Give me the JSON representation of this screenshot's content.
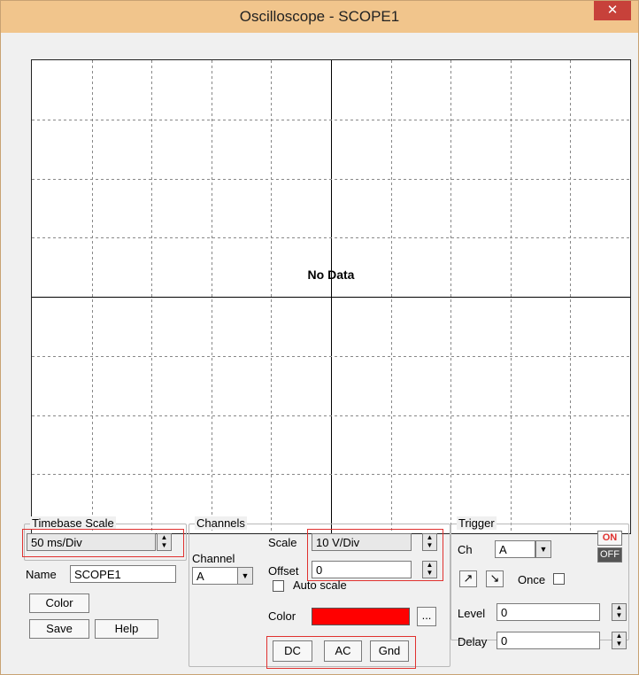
{
  "window": {
    "title": "Oscilloscope - SCOPE1",
    "close_glyph": "✕"
  },
  "display": {
    "empty_message": "No Data",
    "grid_columns": 10,
    "grid_rows": 8
  },
  "timebase": {
    "legend": "Timebase Scale",
    "value": "50 ms/Div",
    "name_label": "Name",
    "name_value": "SCOPE1",
    "color_button": "Color",
    "save_button": "Save",
    "help_button": "Help"
  },
  "channels": {
    "legend": "Channels",
    "channel_label": "Channel",
    "channel_value": "A",
    "scale_label": "Scale",
    "scale_value": "10  V/Div",
    "offset_label": "Offset",
    "offset_value": "0",
    "auto_scale_label": "Auto scale",
    "auto_scale_checked": false,
    "color_label": "Color",
    "color_value": "#ff0000",
    "color_picker_button": "...",
    "coupling_buttons": [
      "DC",
      "AC",
      "Gnd"
    ]
  },
  "trigger": {
    "legend": "Trigger",
    "ch_label": "Ch",
    "ch_value": "A",
    "on_label": "ON",
    "off_label": "OFF",
    "rising_edge_icon": "rising-edge-icon",
    "falling_edge_icon": "falling-edge-icon",
    "once_label": "Once",
    "once_checked": false,
    "level_label": "Level",
    "level_value": "0",
    "delay_label": "Delay",
    "delay_value": "0"
  },
  "colors": {
    "titlebar": "#f1c58c",
    "close_button": "#c7413a",
    "highlight_outline": "#e0312f",
    "trigger_on": "#e0312f"
  }
}
